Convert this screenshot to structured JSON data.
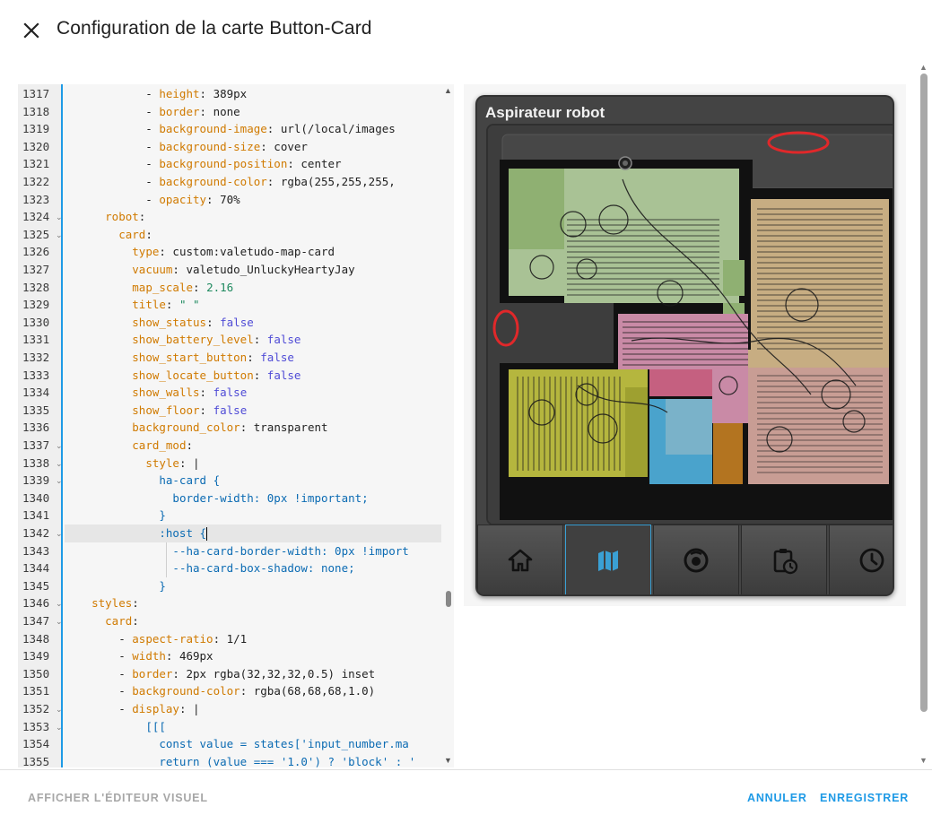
{
  "dialog": {
    "title": "Configuration de la carte Button-Card"
  },
  "editor": {
    "lines": [
      {
        "num": "1317",
        "fold": false,
        "parts": [
          [
            "d",
            "            - "
          ],
          [
            "k",
            "height"
          ],
          [
            "d",
            ": 389px"
          ]
        ]
      },
      {
        "num": "1318",
        "fold": false,
        "parts": [
          [
            "d",
            "            - "
          ],
          [
            "k",
            "border"
          ],
          [
            "d",
            ": none"
          ]
        ]
      },
      {
        "num": "1319",
        "fold": false,
        "parts": [
          [
            "d",
            "            - "
          ],
          [
            "k",
            "background-image"
          ],
          [
            "d",
            ": url(/local/images"
          ]
        ]
      },
      {
        "num": "1320",
        "fold": false,
        "parts": [
          [
            "d",
            "            - "
          ],
          [
            "k",
            "background-size"
          ],
          [
            "d",
            ": cover"
          ]
        ]
      },
      {
        "num": "1321",
        "fold": false,
        "parts": [
          [
            "d",
            "            - "
          ],
          [
            "k",
            "background-position"
          ],
          [
            "d",
            ": center"
          ]
        ]
      },
      {
        "num": "1322",
        "fold": false,
        "parts": [
          [
            "d",
            "            - "
          ],
          [
            "k",
            "background-color"
          ],
          [
            "d",
            ": rgba(255,255,255,"
          ]
        ]
      },
      {
        "num": "1323",
        "fold": false,
        "parts": [
          [
            "d",
            "            - "
          ],
          [
            "k",
            "opacity"
          ],
          [
            "d",
            ": 70%"
          ]
        ]
      },
      {
        "num": "1324",
        "fold": true,
        "parts": [
          [
            "d",
            "      "
          ],
          [
            "k",
            "robot"
          ],
          [
            "d",
            ":"
          ]
        ]
      },
      {
        "num": "1325",
        "fold": true,
        "parts": [
          [
            "d",
            "        "
          ],
          [
            "k",
            "card"
          ],
          [
            "d",
            ":"
          ]
        ]
      },
      {
        "num": "1326",
        "fold": false,
        "parts": [
          [
            "d",
            "          "
          ],
          [
            "k",
            "type"
          ],
          [
            "d",
            ": custom:valetudo-map-card"
          ]
        ]
      },
      {
        "num": "1327",
        "fold": false,
        "parts": [
          [
            "d",
            "          "
          ],
          [
            "k",
            "vacuum"
          ],
          [
            "d",
            ": valetudo_UnluckyHeartyJay"
          ]
        ]
      },
      {
        "num": "1328",
        "fold": false,
        "parts": [
          [
            "d",
            "          "
          ],
          [
            "k",
            "map_scale"
          ],
          [
            "d",
            ": "
          ],
          [
            "n",
            "2.16"
          ]
        ]
      },
      {
        "num": "1329",
        "fold": false,
        "parts": [
          [
            "d",
            "          "
          ],
          [
            "k",
            "title"
          ],
          [
            "d",
            ": "
          ],
          [
            "s",
            "\" \""
          ]
        ]
      },
      {
        "num": "1330",
        "fold": false,
        "parts": [
          [
            "d",
            "          "
          ],
          [
            "k",
            "show_status"
          ],
          [
            "d",
            ": "
          ],
          [
            "b",
            "false"
          ]
        ]
      },
      {
        "num": "1331",
        "fold": false,
        "parts": [
          [
            "d",
            "          "
          ],
          [
            "k",
            "show_battery_level"
          ],
          [
            "d",
            ": "
          ],
          [
            "b",
            "false"
          ]
        ]
      },
      {
        "num": "1332",
        "fold": false,
        "parts": [
          [
            "d",
            "          "
          ],
          [
            "k",
            "show_start_button"
          ],
          [
            "d",
            ": "
          ],
          [
            "b",
            "false"
          ]
        ]
      },
      {
        "num": "1333",
        "fold": false,
        "parts": [
          [
            "d",
            "          "
          ],
          [
            "k",
            "show_locate_button"
          ],
          [
            "d",
            ": "
          ],
          [
            "b",
            "false"
          ]
        ]
      },
      {
        "num": "1334",
        "fold": false,
        "parts": [
          [
            "d",
            "          "
          ],
          [
            "k",
            "show_walls"
          ],
          [
            "d",
            ": "
          ],
          [
            "b",
            "false"
          ]
        ]
      },
      {
        "num": "1335",
        "fold": false,
        "parts": [
          [
            "d",
            "          "
          ],
          [
            "k",
            "show_floor"
          ],
          [
            "d",
            ": "
          ],
          [
            "b",
            "false"
          ]
        ]
      },
      {
        "num": "1336",
        "fold": false,
        "parts": [
          [
            "d",
            "          "
          ],
          [
            "k",
            "background_color"
          ],
          [
            "d",
            ": transparent"
          ]
        ]
      },
      {
        "num": "1337",
        "fold": true,
        "parts": [
          [
            "d",
            "          "
          ],
          [
            "k",
            "card_mod"
          ],
          [
            "d",
            ":"
          ]
        ]
      },
      {
        "num": "1338",
        "fold": true,
        "parts": [
          [
            "d",
            "            "
          ],
          [
            "k",
            "style"
          ],
          [
            "d",
            ": |"
          ]
        ]
      },
      {
        "num": "1339",
        "fold": true,
        "parts": [
          [
            "d",
            "              "
          ],
          [
            "c",
            "ha-card {"
          ]
        ]
      },
      {
        "num": "1340",
        "fold": false,
        "parts": [
          [
            "d",
            "                "
          ],
          [
            "c",
            "border-width: 0px !important;"
          ]
        ]
      },
      {
        "num": "1341",
        "fold": false,
        "parts": [
          [
            "d",
            "              "
          ],
          [
            "c",
            "}"
          ]
        ]
      },
      {
        "num": "1342",
        "fold": true,
        "parts": [
          [
            "d",
            "              "
          ],
          [
            "c",
            ":host {"
          ]
        ]
      },
      {
        "num": "1343",
        "fold": false,
        "parts": [
          [
            "d",
            "                "
          ],
          [
            "c",
            "--ha-card-border-width: 0px !import"
          ]
        ]
      },
      {
        "num": "1344",
        "fold": false,
        "parts": [
          [
            "d",
            "                "
          ],
          [
            "c",
            "--ha-card-box-shadow: none;"
          ]
        ]
      },
      {
        "num": "1345",
        "fold": false,
        "parts": [
          [
            "d",
            "              "
          ],
          [
            "c",
            "}"
          ]
        ]
      },
      {
        "num": "1346",
        "fold": true,
        "parts": [
          [
            "d",
            "    "
          ],
          [
            "k",
            "styles"
          ],
          [
            "d",
            ":"
          ]
        ]
      },
      {
        "num": "1347",
        "fold": true,
        "parts": [
          [
            "d",
            "      "
          ],
          [
            "k",
            "card"
          ],
          [
            "d",
            ":"
          ]
        ]
      },
      {
        "num": "1348",
        "fold": false,
        "parts": [
          [
            "d",
            "        - "
          ],
          [
            "k",
            "aspect-ratio"
          ],
          [
            "d",
            ": 1/1"
          ]
        ]
      },
      {
        "num": "1349",
        "fold": false,
        "parts": [
          [
            "d",
            "        - "
          ],
          [
            "k",
            "width"
          ],
          [
            "d",
            ": 469px"
          ]
        ]
      },
      {
        "num": "1350",
        "fold": false,
        "parts": [
          [
            "d",
            "        - "
          ],
          [
            "k",
            "border"
          ],
          [
            "d",
            ": 2px rgba(32,32,32,0.5) inset"
          ]
        ]
      },
      {
        "num": "1351",
        "fold": false,
        "parts": [
          [
            "d",
            "        - "
          ],
          [
            "k",
            "background-color"
          ],
          [
            "d",
            ": rgba(68,68,68,1.0)"
          ]
        ]
      },
      {
        "num": "1352",
        "fold": true,
        "parts": [
          [
            "d",
            "        - "
          ],
          [
            "k",
            "display"
          ],
          [
            "d",
            ": |"
          ]
        ]
      },
      {
        "num": "1353",
        "fold": true,
        "parts": [
          [
            "d",
            "            "
          ],
          [
            "c",
            "[[["
          ]
        ]
      },
      {
        "num": "1354",
        "fold": false,
        "parts": [
          [
            "d",
            "              "
          ],
          [
            "c",
            "const value = states['input_number.ma"
          ]
        ]
      },
      {
        "num": "1355",
        "fold": false,
        "parts": [
          [
            "d",
            "              "
          ],
          [
            "c",
            "return (value === '1.0') ? 'block' : '"
          ]
        ]
      }
    ]
  },
  "preview": {
    "card_title": "Aspirateur robot",
    "nav": [
      {
        "icon": "home-icon",
        "active": false
      },
      {
        "icon": "map-icon",
        "active": true
      },
      {
        "icon": "robot-vacuum-icon",
        "active": false
      },
      {
        "icon": "clipboard-clock-icon",
        "active": false
      },
      {
        "icon": "clock-icon",
        "active": false
      }
    ],
    "colors": {
      "accent": "#3aa0d4",
      "room_green": "#8fb072",
      "room_sage": "#a9c295",
      "room_tan": "#c7ad82",
      "room_pink": "#c98aa6",
      "room_salmon": "#c89d94",
      "room_yellow": "#b5b63e",
      "room_blue": "#5aa6c9",
      "room_rose": "#c56080",
      "room_orange": "#b37420"
    }
  },
  "footer": {
    "visual_editor": "AFFICHER L'ÉDITEUR VISUEL",
    "cancel": "ANNULER",
    "save": "ENREGISTRER"
  }
}
